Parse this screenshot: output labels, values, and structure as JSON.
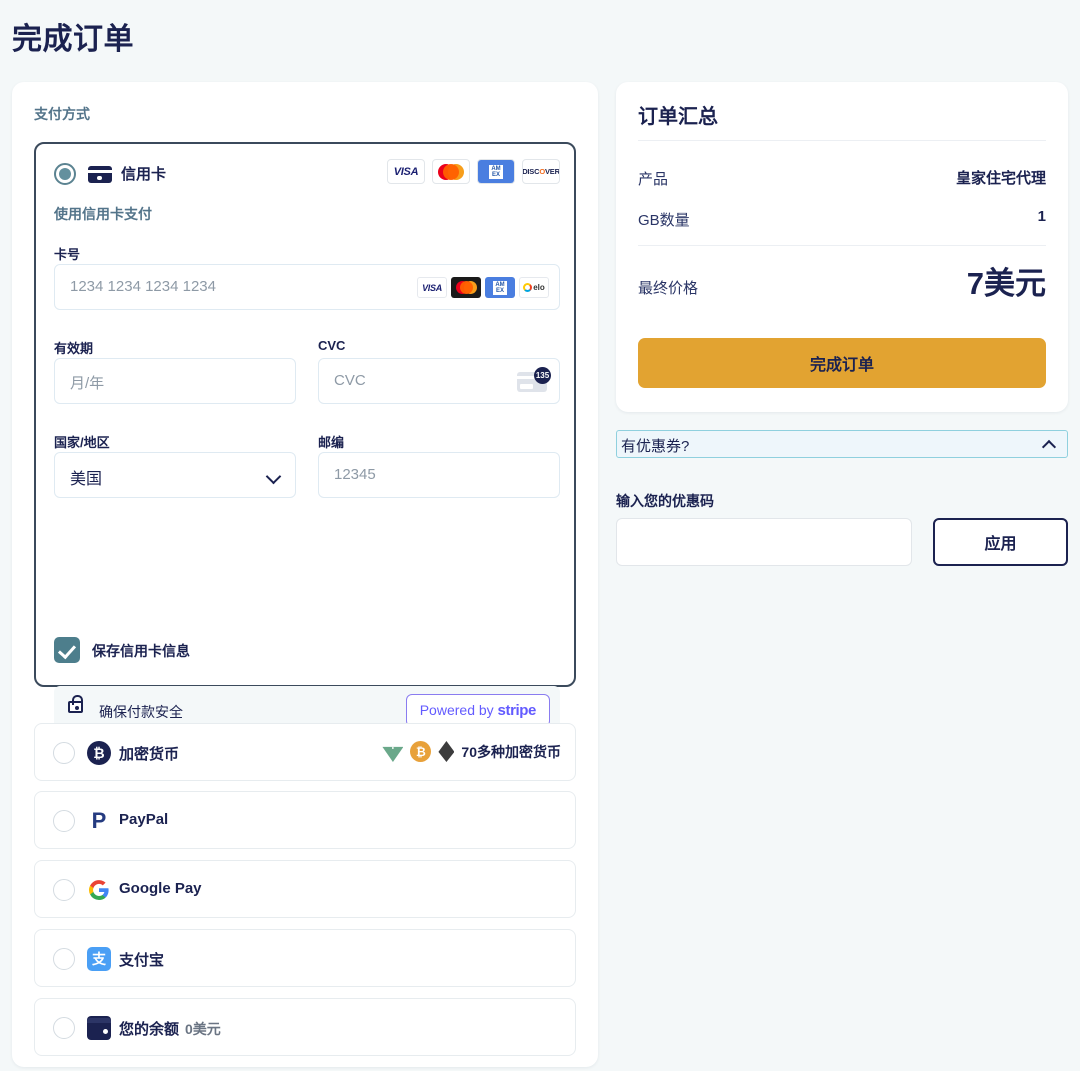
{
  "page": {
    "title": "完成订单"
  },
  "payment": {
    "section_label": "支付方式",
    "credit_card": {
      "title": "信用卡",
      "card_icon": "credit-card-icon",
      "subtitle": "使用信用卡支付",
      "accepted_brands": [
        "VISA",
        "Mastercard",
        "AMEX",
        "DISCOVER"
      ],
      "discover_text_pre": "DISC",
      "discover_text_mid": "O",
      "discover_text_post": "VER",
      "amex_line1": "AM",
      "amex_line2": "EX",
      "fields": {
        "card_number_label": "卡号",
        "card_number_placeholder": "1234 1234 1234 1234",
        "card_number_value": "",
        "inline_brands": [
          "VISA",
          "Mastercard",
          "AMEX",
          "elo"
        ],
        "elo_text": "elo",
        "expiry_label": "有效期",
        "expiry_placeholder": "月/年",
        "expiry_value": "",
        "cvc_label": "CVC",
        "cvc_placeholder": "CVC",
        "cvc_value": "",
        "cvc_hint_digits": "135",
        "country_label": "国家/地区",
        "country_value": "美国",
        "zip_label": "邮编",
        "zip_placeholder": "12345",
        "zip_value": ""
      },
      "save_card_label": "保存信用卡信息",
      "save_card_checked": true,
      "secure_text": "确保付款安全",
      "stripe_prefix": "Powered by ",
      "stripe_brand": "stripe"
    },
    "other_methods": [
      {
        "label": "加密货币",
        "icon": "bitcoin-badge-icon",
        "extra": "70多种加密货币",
        "selected": false
      },
      {
        "label": "PayPal",
        "icon": "paypal-icon",
        "extra": "",
        "selected": false
      },
      {
        "label": "Google Pay",
        "icon": "google-icon",
        "extra": "",
        "selected": false
      },
      {
        "label": "支付宝",
        "icon": "alipay-icon",
        "extra": "",
        "selected": false
      },
      {
        "label": "您的余额",
        "icon": "wallet-icon",
        "extra": "0美元",
        "selected": false
      }
    ]
  },
  "summary": {
    "title": "订单汇总",
    "rows": [
      {
        "key": "产品",
        "value": "皇家住宅代理"
      },
      {
        "key": "GB数量",
        "value": "1"
      }
    ],
    "final_price_label": "最终价格",
    "final_price_value": "7美元",
    "cta_label": "完成订单"
  },
  "coupon": {
    "toggle_label": "有优惠券?",
    "expanded": true,
    "input_label": "输入您的优惠码",
    "input_value": "",
    "apply_label": "应用"
  },
  "colors": {
    "page_bg": "#f4f8f9",
    "navy": "#1b2250",
    "muted": "#53748a",
    "accent_amber": "#e2a331",
    "selected_border": "#3b4a5c",
    "radio_teal": "#63909e",
    "checkbox_teal": "#4d7e8c",
    "coupon_border": "#8fd0de",
    "stripe_purple": "#635bff"
  }
}
